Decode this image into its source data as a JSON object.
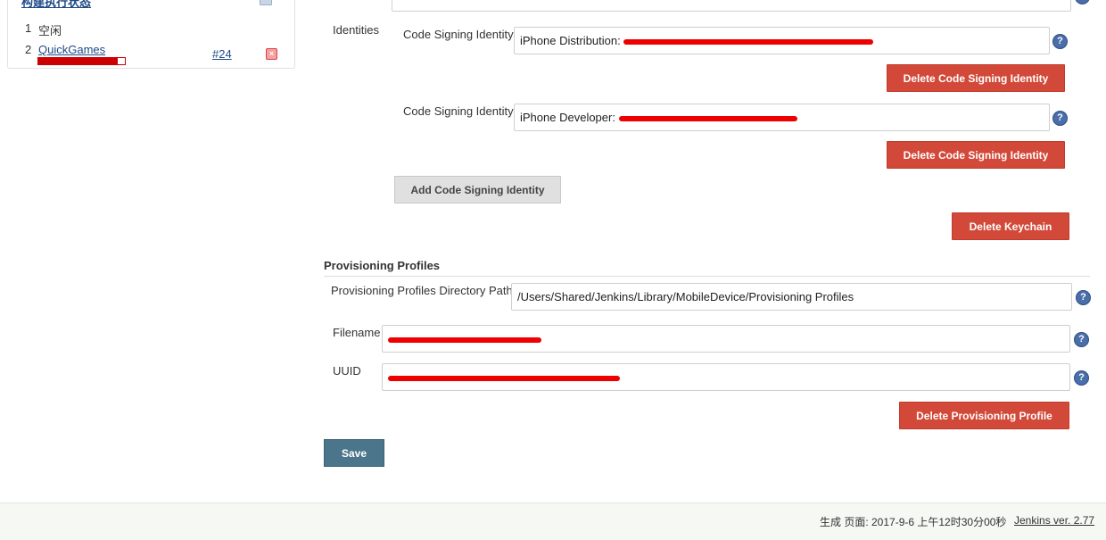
{
  "executor": {
    "header": "构建执行状态",
    "rows": [
      {
        "num": "1",
        "label": "空闲"
      },
      {
        "num": "2",
        "label": "QuickGames",
        "build": "#24",
        "progress": 0.92
      }
    ]
  },
  "identities": {
    "section_label": "Identities",
    "code_signing_label": "Code Signing Identity",
    "items": [
      {
        "value": "iPhone Distribution:",
        "delete_label": "Delete Code Signing Identity"
      },
      {
        "value": "iPhone Developer:",
        "delete_label": "Delete Code Signing Identity"
      }
    ],
    "add_label": "Add Code Signing Identity",
    "delete_keychain_label": "Delete Keychain"
  },
  "provisioning": {
    "title": "Provisioning Profiles",
    "dir_label": "Provisioning Profiles Directory Path",
    "dir_value": "/Users/Shared/Jenkins/Library/MobileDevice/Provisioning Profiles",
    "filename_label": "Filename",
    "filename_value": "",
    "uuid_label": "UUID",
    "uuid_value": "",
    "delete_label": "Delete Provisioning Profile"
  },
  "save_label": "Save",
  "footer": {
    "generated": "生成 页面: 2017-9-6 上午12时30分00秒",
    "version": "Jenkins ver. 2.77"
  },
  "colors": {
    "accent_red": "#d24939",
    "save_blue": "#4b758b",
    "link": "#204a87",
    "redaction": "#e00000"
  },
  "icons": {
    "help": "question-mark-icon",
    "stop": "stop-build-icon"
  }
}
